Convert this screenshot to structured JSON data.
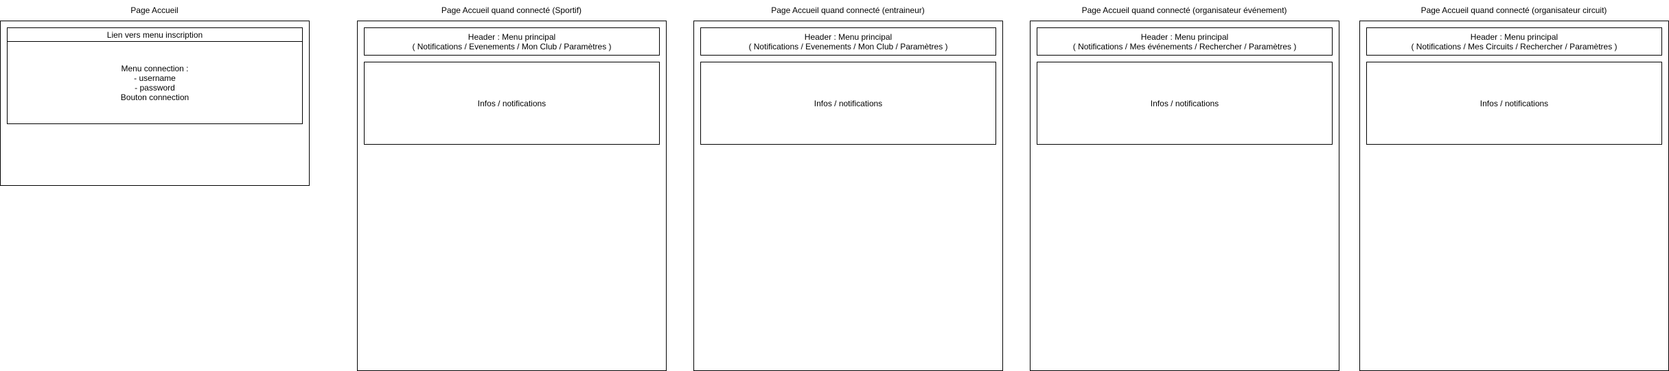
{
  "pages": [
    {
      "title": "Page Accueil",
      "header": "Lien vers menu inscription",
      "body": "Menu connection :\n- username\n- password\nBouton connection"
    },
    {
      "title": "Page Accueil quand connecté (Sportif)",
      "header": "Header : Menu principal\n( Notifications / Evenements / Mon Club /  Paramètres )",
      "body": "Infos / notifications"
    },
    {
      "title": "Page Accueil quand connecté (entraineur)",
      "header": "Header : Menu principal\n( Notifications / Evenements / Mon Club /  Paramètres )",
      "body": "Infos / notifications"
    },
    {
      "title": "Page Accueil quand connecté (organisateur événement)",
      "header": "Header : Menu principal\n( Notifications / Mes événements / Rechercher /  Paramètres )",
      "body": "Infos / notifications"
    },
    {
      "title": "Page Accueil quand connecté (organisateur circuit)",
      "header": "Header : Menu principal\n( Notifications / Mes Circuits / Rechercher /  Paramètres )",
      "body": "Infos / notifications"
    }
  ]
}
